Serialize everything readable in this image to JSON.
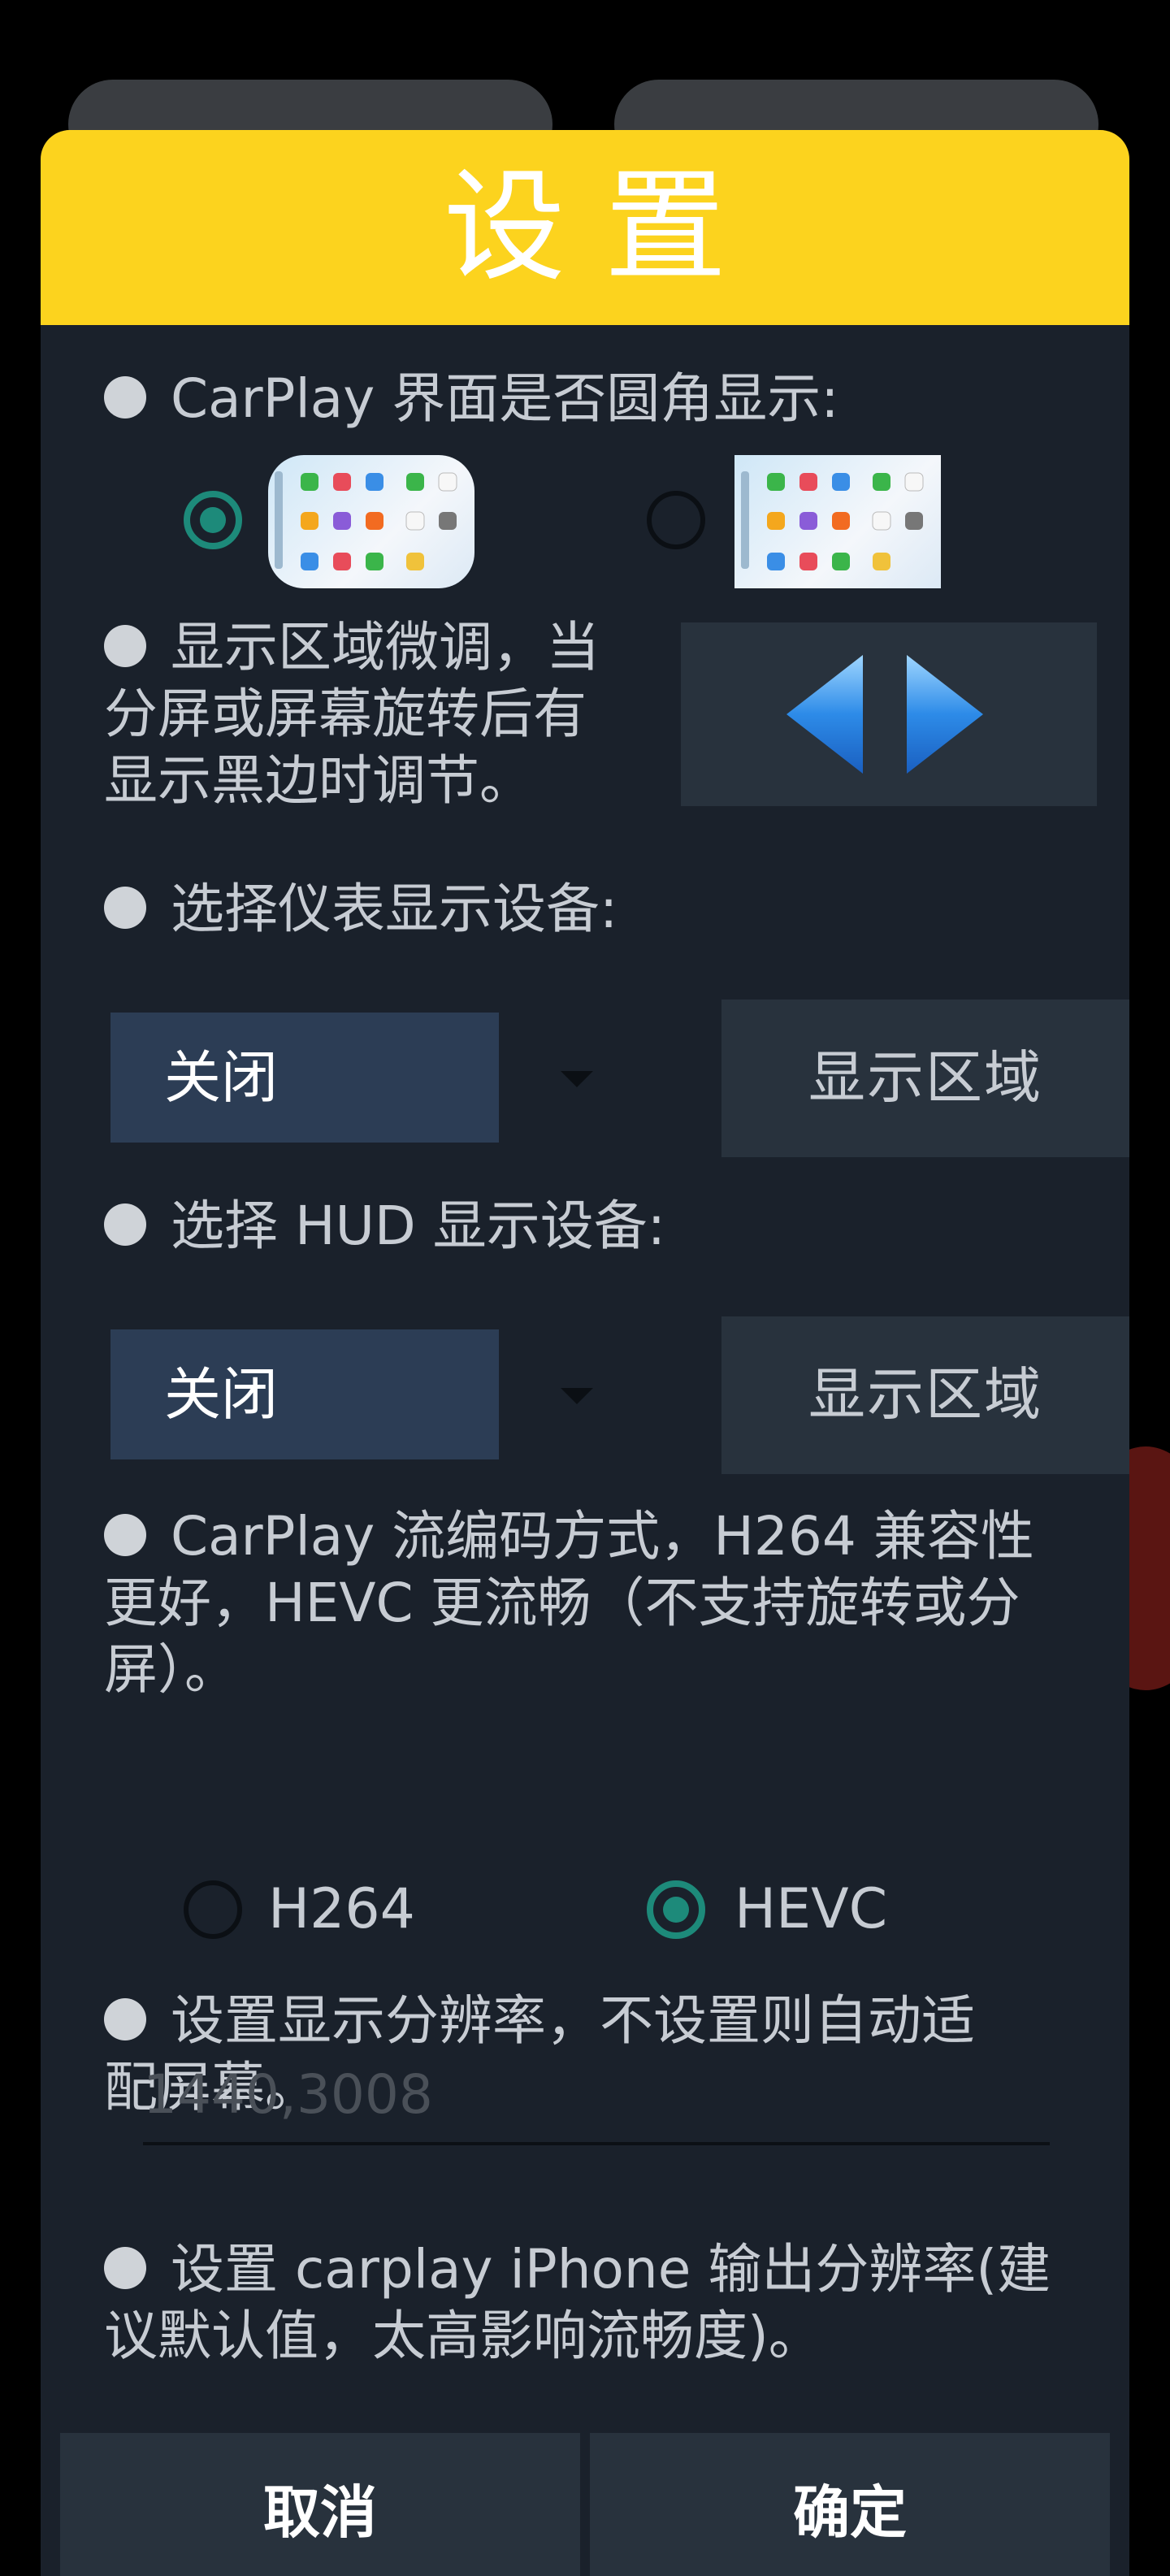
{
  "dialog": {
    "title": "设置",
    "icons": {
      "arrows": "left-right-arrow-icon",
      "dropdown_caret": "chevron-down-icon"
    },
    "colors": {
      "header": "#fcd31e",
      "background": "#1a212b",
      "radio_selected": "#1d8a7a",
      "dropdown": "#2c3d55"
    }
  },
  "rounded_corner": {
    "label": "CarPlay 界面是否圆角显示:"
  },
  "fine_tune": {
    "label_line1": "显示区域微调，当",
    "label_line2": "分屏或屏幕旋转后有",
    "label_line3": "显示黑边时调节。"
  },
  "instrument": {
    "label": "选择仪表显示设备:",
    "selected": "关闭",
    "area_button": "显示区域"
  },
  "hud": {
    "label": "选择 HUD 显示设备:",
    "selected": "关闭",
    "area_button": "显示区域"
  },
  "codec": {
    "label_line1": "CarPlay 流编码方式，H264 兼容性",
    "label_line2": "更好，HEVC 更流畅（不支持旋转或分",
    "label_line3": "屏）。",
    "option_h264": "H264",
    "option_hevc": "HEVC",
    "selected": "HEVC"
  },
  "resolution": {
    "label_line1": "设置显示分辨率，不设置则自动适",
    "label_line2": "配屏幕。",
    "placeholder": "1440,3008"
  },
  "iphone_resolution": {
    "label_line1": "设置 carplay iPhone 输出分辨率(建",
    "label_line2": "议默认值，太高影响流畅度)。"
  },
  "footer": {
    "cancel": "取消",
    "confirm": "确定"
  }
}
